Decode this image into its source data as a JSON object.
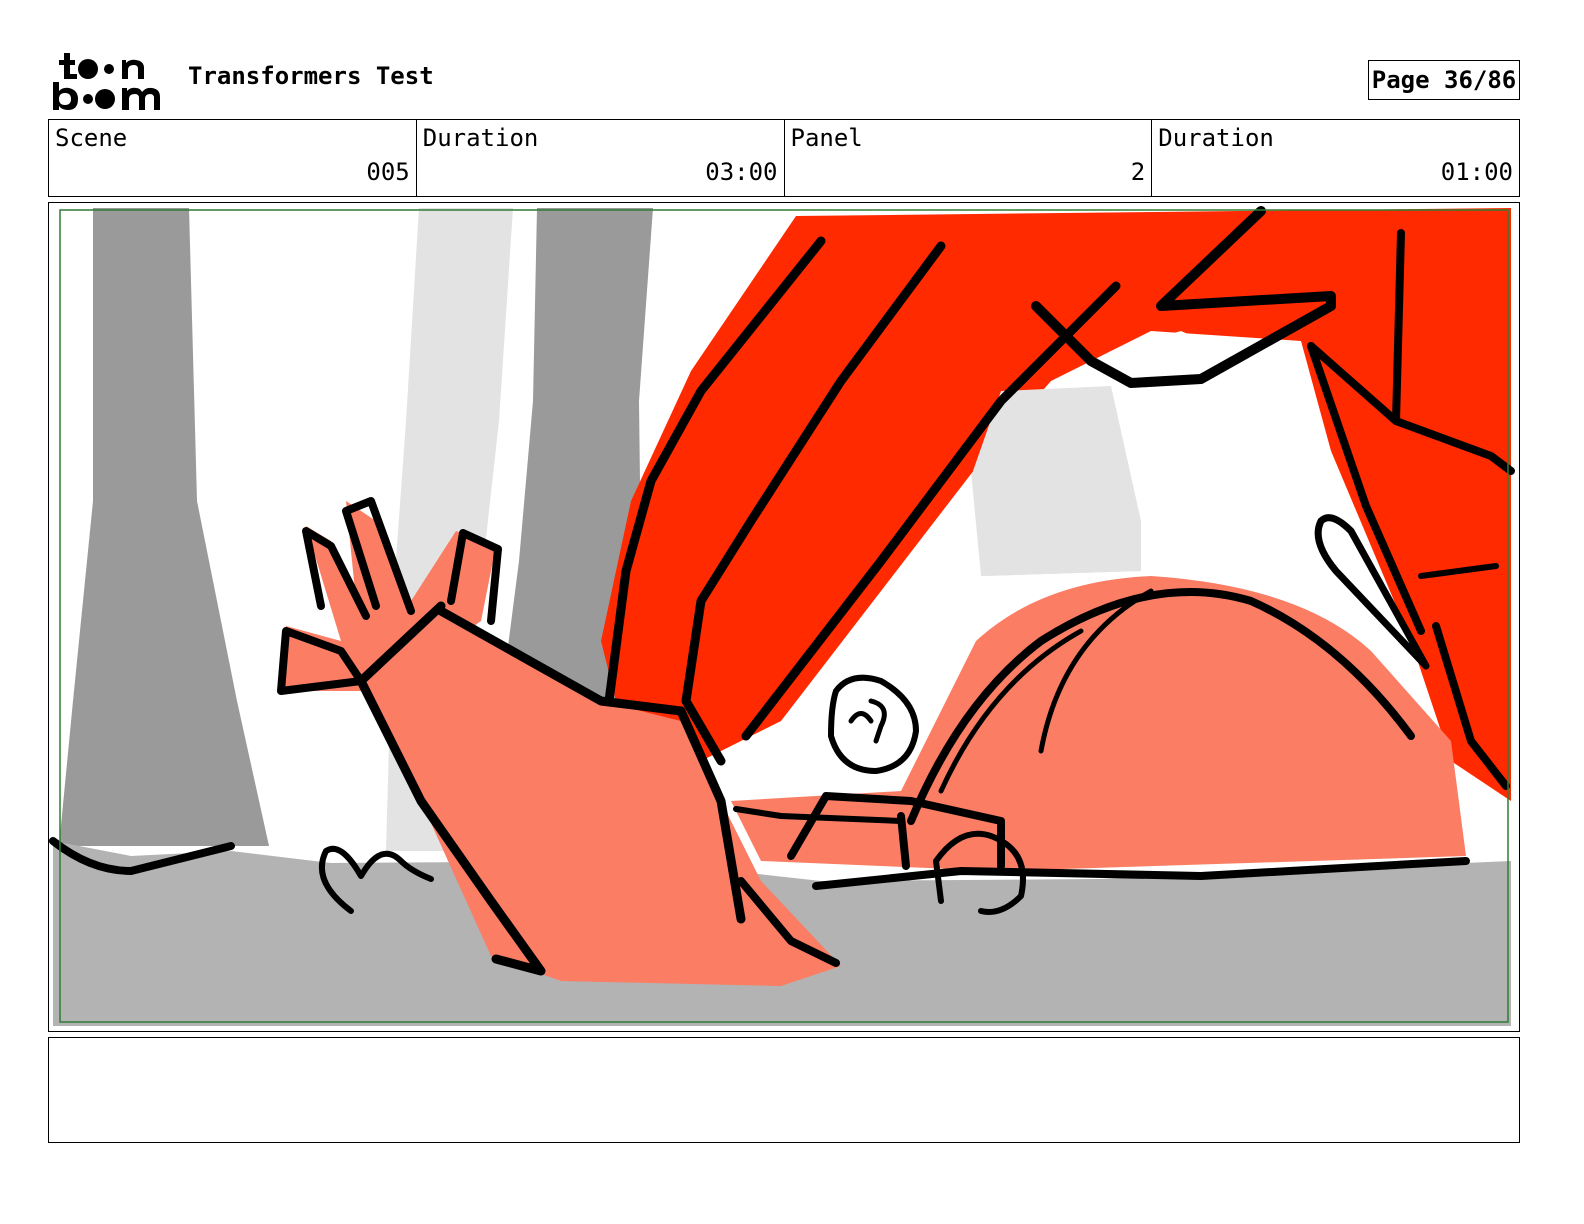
{
  "header": {
    "title": "Transformers Test",
    "page_label": "Page 36/86"
  },
  "info": {
    "scene_label": "Scene",
    "scene_value": "005",
    "scene_duration_label": "Duration",
    "scene_duration_value": "03:00",
    "panel_label": "Panel",
    "panel_value": "2",
    "panel_duration_label": "Duration",
    "panel_duration_value": "01:00"
  },
  "notes": {
    "text": ""
  },
  "colors": {
    "red": "#ff2a00",
    "salmon": "#fa7d64",
    "gray_dark": "#9a9a9a",
    "gray_light": "#e3e3e3",
    "ground": "#b3b3b3",
    "safe_frame": "#2e7d32"
  },
  "icons": {
    "logo": "toon-boom-logo"
  }
}
